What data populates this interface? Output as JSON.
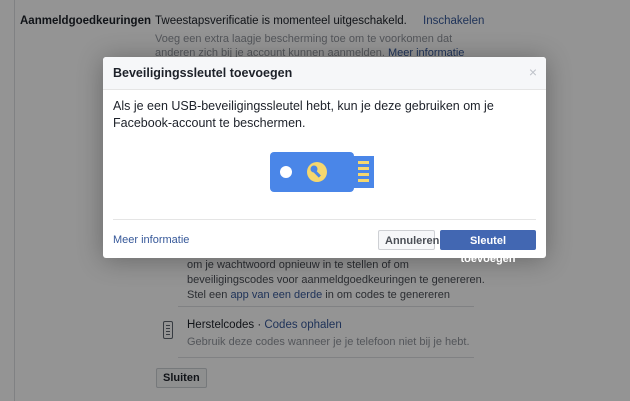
{
  "page": {
    "login_approvals": {
      "label": "Aanmeldgoedkeuringen",
      "status": "Tweestapsverificatie is momenteel uitgeschakeld.",
      "action": "Inschakelen",
      "description": "Voeg een extra laagje bescherming toe om te voorkomen dat anderen zich bij je account kunnen aanmelden.",
      "more_info": "Meer informatie"
    },
    "hidden_text": {
      "text_before": "om je wachtwoord opnieuw in te stellen of om beveiligingscodes voor aanmeldgoedkeuringen te genereren. Stel een",
      "link": "app van een derde",
      "text_after": "in om codes te genereren"
    },
    "recovery_codes": {
      "title": "Herstelcodes",
      "separator": " · ",
      "action": "Codes ophalen",
      "description": "Gebruik deze codes wanneer je je telefoon niet bij je hebt."
    },
    "close_button": "Sluiten"
  },
  "dialog": {
    "title": "Beveiligingssleutel toevoegen",
    "close_glyph": "×",
    "body": "Als je een USB-beveiligingssleutel hebt, kun je deze gebruiken om je Facebook-account te beschermen.",
    "more_info": "Meer informatie",
    "cancel_label": "Annuleren",
    "primary_label": "Sleutel toevoegen"
  },
  "colors": {
    "brand_blue": "#4267b2",
    "link_blue": "#365899",
    "usb_body": "#4a86e8",
    "usb_accent": "#f5d76e",
    "overlay": "rgba(0,0,0,0.42)"
  },
  "icons": {
    "usb": "usb-security-key-icon",
    "recovery": "phone-codes-icon",
    "close": "close-icon"
  }
}
